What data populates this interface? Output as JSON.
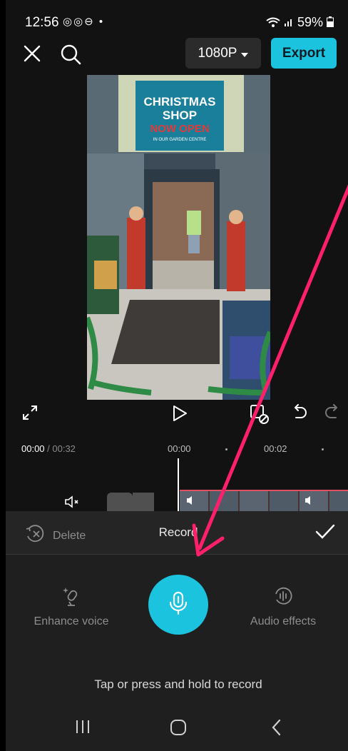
{
  "status_bar": {
    "time": "12:56",
    "notifications": "◎◎⊖ •",
    "battery": "59%"
  },
  "toolbar": {
    "resolution_label": "1080P",
    "export_label": "Export"
  },
  "preview": {
    "sign_line1": "CHRISTMAS",
    "sign_line2": "SHOP",
    "sign_line3": "NOW OPEN",
    "sign_line4": "IN OUR GARDEN CENTRE"
  },
  "timeline": {
    "current_time": "00:00",
    "total_time": " / 00:32",
    "tick_0": "00:00",
    "tick_1": "00:02"
  },
  "record_panel": {
    "delete_label": "Delete",
    "title": "Record",
    "enhance_voice_label": "Enhance voice",
    "audio_effects_label": "Audio effects",
    "hint": "Tap or press and hold to record"
  },
  "colors": {
    "accent": "#1cc3de",
    "annotation_arrow": "#ff1f6b"
  }
}
